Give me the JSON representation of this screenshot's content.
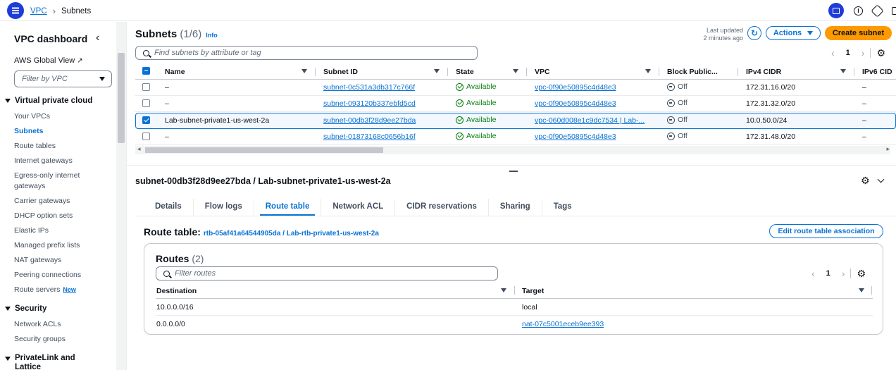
{
  "breadcrumb": {
    "root": "VPC",
    "current": "Subnets"
  },
  "sidebar": {
    "title": "VPC dashboard",
    "global_view": "AWS Global View",
    "filter_placeholder": "Filter by VPC",
    "sections": [
      {
        "label": "Virtual private cloud",
        "items": [
          "Your VPCs",
          "Subnets",
          "Route tables",
          "Internet gateways",
          "Egress-only internet gateways",
          "Carrier gateways",
          "DHCP option sets",
          "Elastic IPs",
          "Managed prefix lists",
          "NAT gateways",
          "Peering connections",
          "Route servers"
        ]
      },
      {
        "label": "Security",
        "items": [
          "Network ACLs",
          "Security groups"
        ]
      },
      {
        "label": "PrivateLink and Lattice",
        "items": []
      }
    ],
    "new_badge": "New",
    "active_item": "Subnets"
  },
  "subnets": {
    "title": "Subnets",
    "count": "(1/6)",
    "info": "Info",
    "last_updated_label": "Last updated",
    "last_updated_value": "2 minutes ago",
    "actions_label": "Actions",
    "create_label": "Create subnet",
    "search_placeholder": "Find subnets by attribute or tag",
    "page": "1",
    "columns": [
      "Name",
      "Subnet ID",
      "State",
      "VPC",
      "Block Public...",
      "IPv4 CIDR",
      "IPv6 CID"
    ],
    "rows": [
      {
        "name": "–",
        "subnet_id": "subnet-0c531a3db317c766f",
        "state": "Available",
        "vpc": "vpc-0f90e50895c4d48e3",
        "block": "Off",
        "ipv4": "172.31.16.0/20",
        "ipv6": "–",
        "selected": false
      },
      {
        "name": "–",
        "subnet_id": "subnet-093120b337ebfd5cd",
        "state": "Available",
        "vpc": "vpc-0f90e50895c4d48e3",
        "block": "Off",
        "ipv4": "172.31.32.0/20",
        "ipv6": "–",
        "selected": false
      },
      {
        "name": "Lab-subnet-private1-us-west-2a",
        "subnet_id": "subnet-00db3f28d9ee27bda",
        "state": "Available",
        "vpc": "vpc-060d008e1c9dc7534 | Lab-...",
        "block": "Off",
        "ipv4": "10.0.50.0/24",
        "ipv6": "–",
        "selected": true
      },
      {
        "name": "–",
        "subnet_id": "subnet-01873168c0656b16f",
        "state": "Available",
        "vpc": "vpc-0f90e50895c4d48e3",
        "block": "Off",
        "ipv4": "172.31.48.0/20",
        "ipv6": "–",
        "selected": false
      }
    ]
  },
  "detail": {
    "title": "subnet-00db3f28d9ee27bda / Lab-subnet-private1-us-west-2a",
    "tabs": [
      "Details",
      "Flow logs",
      "Route table",
      "Network ACL",
      "CIDR reservations",
      "Sharing",
      "Tags"
    ],
    "active_tab": "Route table",
    "route_table_label": "Route table:",
    "route_table_link": "rtb-05af41a64544905da / Lab-rtb-private1-us-west-2a",
    "edit_button": "Edit route table association",
    "routes_title": "Routes",
    "routes_count": "(2)",
    "routes_search_placeholder": "Filter routes",
    "routes_page": "1",
    "routes_columns": [
      "Destination",
      "Target"
    ],
    "routes": [
      {
        "destination": "10.0.0.0/16",
        "target": "local",
        "target_link": false
      },
      {
        "destination": "0.0.0.0/0",
        "target": "nat-07c5001eceb9ee393",
        "target_link": true
      }
    ]
  },
  "colors": {
    "primary": "#0972d3",
    "brand_blue": "#1f3cd8",
    "create_button": "#ff9900",
    "available_green": "#037f0c"
  }
}
